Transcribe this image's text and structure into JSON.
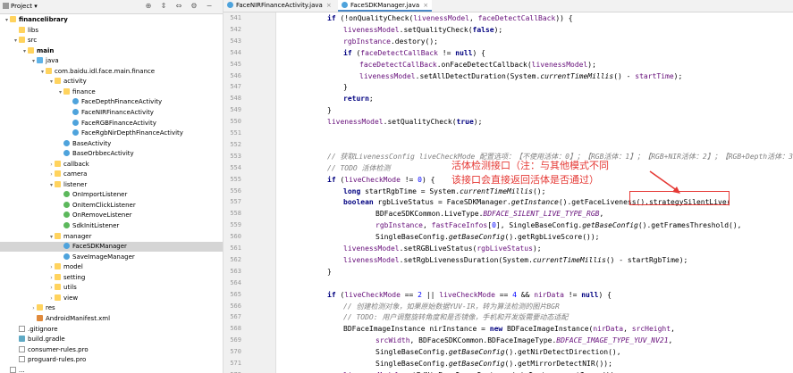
{
  "project_panel": {
    "title": "Project",
    "title_chevron": "▾",
    "toolbar_icons": [
      "target-icon",
      "expand-icon",
      "collapse-icon",
      "gear-icon",
      "minimize-icon"
    ],
    "toolbar_glyphs": [
      "⊕",
      "⇕",
      "⇔",
      "⚙",
      "−"
    ],
    "tree": [
      {
        "label": "financelibrary",
        "depth": 0,
        "chev": "▾",
        "icon": "folder",
        "bold": true
      },
      {
        "label": "libs",
        "depth": 1,
        "chev": "",
        "icon": "folder"
      },
      {
        "label": "src",
        "depth": 1,
        "chev": "▾",
        "icon": "folder"
      },
      {
        "label": "main",
        "depth": 2,
        "chev": "▾",
        "icon": "folder",
        "bold": true
      },
      {
        "label": "java",
        "depth": 3,
        "chev": "▾",
        "icon": "src"
      },
      {
        "label": "com.baidu.idl.face.main.finance",
        "depth": 4,
        "chev": "▾",
        "icon": "pkg"
      },
      {
        "label": "activity",
        "depth": 5,
        "chev": "▾",
        "icon": "pkg"
      },
      {
        "label": "finance",
        "depth": 6,
        "chev": "▾",
        "icon": "pkg"
      },
      {
        "label": "FaceDepthFinanceActivity",
        "depth": 7,
        "chev": "",
        "icon": "class"
      },
      {
        "label": "FaceNIRFinanceActivity",
        "depth": 7,
        "chev": "",
        "icon": "class"
      },
      {
        "label": "FaceRGBFinanceActivity",
        "depth": 7,
        "chev": "",
        "icon": "class"
      },
      {
        "label": "FaceRgbNirDepthFinanceActivity",
        "depth": 7,
        "chev": "",
        "icon": "class"
      },
      {
        "label": "BaseActivity",
        "depth": 6,
        "chev": "",
        "icon": "class"
      },
      {
        "label": "BaseOrbbecActivity",
        "depth": 6,
        "chev": "",
        "icon": "class"
      },
      {
        "label": "callback",
        "depth": 5,
        "chev": "›",
        "icon": "pkg"
      },
      {
        "label": "camera",
        "depth": 5,
        "chev": "›",
        "icon": "pkg"
      },
      {
        "label": "listener",
        "depth": 5,
        "chev": "▾",
        "icon": "pkg"
      },
      {
        "label": "OnImportListener",
        "depth": 6,
        "chev": "",
        "icon": "iface"
      },
      {
        "label": "OnItemClickListener",
        "depth": 6,
        "chev": "",
        "icon": "iface"
      },
      {
        "label": "OnRemoveListener",
        "depth": 6,
        "chev": "",
        "icon": "iface"
      },
      {
        "label": "SdkInitListener",
        "depth": 6,
        "chev": "",
        "icon": "iface"
      },
      {
        "label": "manager",
        "depth": 5,
        "chev": "▾",
        "icon": "pkg"
      },
      {
        "label": "FaceSDKManager",
        "depth": 6,
        "chev": "",
        "icon": "class",
        "selected": true
      },
      {
        "label": "SaveImageManager",
        "depth": 6,
        "chev": "",
        "icon": "class"
      },
      {
        "label": "model",
        "depth": 5,
        "chev": "›",
        "icon": "pkg"
      },
      {
        "label": "setting",
        "depth": 5,
        "chev": "›",
        "icon": "pkg"
      },
      {
        "label": "utils",
        "depth": 5,
        "chev": "›",
        "icon": "pkg"
      },
      {
        "label": "view",
        "depth": 5,
        "chev": "›",
        "icon": "pkg"
      },
      {
        "label": "res",
        "depth": 3,
        "chev": "›",
        "icon": "folder"
      },
      {
        "label": "AndroidManifest.xml",
        "depth": 3,
        "chev": "",
        "icon": "xml"
      },
      {
        "label": ".gitignore",
        "depth": 1,
        "chev": "",
        "icon": "file"
      },
      {
        "label": "build.gradle",
        "depth": 1,
        "chev": "",
        "icon": "gradle"
      },
      {
        "label": "consumer-rules.pro",
        "depth": 1,
        "chev": "",
        "icon": "file"
      },
      {
        "label": "proguard-rules.pro",
        "depth": 1,
        "chev": "",
        "icon": "file"
      },
      {
        "label": "...",
        "depth": 0,
        "chev": "",
        "icon": "file"
      }
    ]
  },
  "editor": {
    "tabs": [
      {
        "label": "FaceNIRFinanceActivity.java",
        "close": "×",
        "active": false
      },
      {
        "label": "FaceSDKManager.java",
        "close": "×",
        "active": true
      }
    ],
    "lines": [
      {
        "num": "541",
        "indent": 0,
        "tokens": [
          [
            "kw",
            "if "
          ],
          [
            "",
            "(!onQualityCheck("
          ],
          [
            "fld",
            "livenessModel"
          ],
          [
            "",
            ", "
          ],
          [
            "fld",
            "faceDetectCallBack"
          ],
          [
            "",
            ")) {"
          ]
        ]
      },
      {
        "num": "542",
        "indent": 1,
        "tokens": [
          [
            "fld",
            "livenessModel"
          ],
          [
            "",
            ".setQualityCheck("
          ],
          [
            "kw",
            "false"
          ],
          [
            "",
            ");"
          ]
        ]
      },
      {
        "num": "543",
        "indent": 1,
        "tokens": [
          [
            "fld",
            "rgbInstance"
          ],
          [
            "",
            ".destory();"
          ]
        ]
      },
      {
        "num": "544",
        "indent": 1,
        "tokens": [
          [
            "kw",
            "if "
          ],
          [
            "",
            "("
          ],
          [
            "fld",
            "faceDetectCallBack"
          ],
          [
            "",
            " != "
          ],
          [
            "kw",
            "null"
          ],
          [
            "",
            ") {"
          ]
        ]
      },
      {
        "num": "545",
        "indent": 2,
        "tokens": [
          [
            "fld",
            "faceDetectCallBack"
          ],
          [
            "",
            ".onFaceDetectCallback("
          ],
          [
            "fld",
            "livenessModel"
          ],
          [
            "",
            ");"
          ]
        ]
      },
      {
        "num": "546",
        "indent": 2,
        "tokens": [
          [
            "fld",
            "livenessModel"
          ],
          [
            "",
            ".setAllDetectDuration(System."
          ],
          [
            "st",
            "currentTimeMillis"
          ],
          [
            "",
            "() - "
          ],
          [
            "fld",
            "startTime"
          ],
          [
            "",
            ");"
          ]
        ]
      },
      {
        "num": "547",
        "indent": 1,
        "tokens": [
          [
            "",
            "}"
          ]
        ]
      },
      {
        "num": "548",
        "indent": 1,
        "tokens": [
          [
            "kw",
            "return"
          ],
          [
            "",
            ";"
          ]
        ]
      },
      {
        "num": "549",
        "indent": 0,
        "tokens": [
          [
            "",
            "}"
          ]
        ]
      },
      {
        "num": "550",
        "indent": 0,
        "tokens": [
          [
            "fld",
            "livenessModel"
          ],
          [
            "",
            ".setQualityCheck("
          ],
          [
            "kw",
            "true"
          ],
          [
            "",
            ");"
          ]
        ]
      },
      {
        "num": "551",
        "indent": 0,
        "tokens": []
      },
      {
        "num": "552",
        "indent": 0,
        "tokens": []
      },
      {
        "num": "553",
        "indent": 0,
        "tokens": [
          [
            "cm",
            "// 获取LivenessConfig liveCheckMode 配置选项：【不使用活体：0】；【RGB活体：1】；【RGB+NIR活体：2】；【RGB+Depth活体：3】；【RGB+NIR+Depth活体：4】"
          ]
        ]
      },
      {
        "num": "554",
        "indent": 0,
        "tokens": [
          [
            "cm",
            "// TODO 活体检测"
          ]
        ]
      },
      {
        "num": "555",
        "indent": 0,
        "tokens": [
          [
            "kw",
            "if "
          ],
          [
            "",
            "("
          ],
          [
            "fld",
            "liveCheckMode"
          ],
          [
            "",
            " != "
          ],
          [
            "num",
            "0"
          ],
          [
            "",
            ") {"
          ]
        ]
      },
      {
        "num": "556",
        "indent": 1,
        "tokens": [
          [
            "kw",
            "long "
          ],
          [
            "",
            "startRgbTime = System."
          ],
          [
            "st",
            "currentTimeMillis"
          ],
          [
            "",
            "();"
          ]
        ]
      },
      {
        "num": "557",
        "indent": 1,
        "tokens": [
          [
            "kw",
            "boolean "
          ],
          [
            "",
            "rgbLiveStatus = FaceSDKManager."
          ],
          [
            "st",
            "getInstance"
          ],
          [
            "",
            "().getFaceLiveness().strategySilentLive("
          ]
        ]
      },
      {
        "num": "558",
        "indent": 3,
        "tokens": [
          [
            "",
            "BDFaceSDKCommon.LiveType."
          ],
          [
            "cst",
            "BDFACE_SILENT_LIVE_TYPE_RGB"
          ],
          [
            "",
            ","
          ]
        ]
      },
      {
        "num": "559",
        "indent": 3,
        "tokens": [
          [
            "fld",
            "rgbInstance"
          ],
          [
            "",
            ", "
          ],
          [
            "fld",
            "fastFaceInfos"
          ],
          [
            "",
            "["
          ],
          [
            "num",
            "0"
          ],
          [
            "",
            "], SingleBaseConfig."
          ],
          [
            "st",
            "getBaseConfig"
          ],
          [
            "",
            "().getFramesThreshold(),"
          ]
        ]
      },
      {
        "num": "560",
        "indent": 3,
        "tokens": [
          [
            "",
            "SingleBaseConfig."
          ],
          [
            "st",
            "getBaseConfig"
          ],
          [
            "",
            "().getRgbLiveScore());"
          ]
        ]
      },
      {
        "num": "561",
        "indent": 1,
        "tokens": [
          [
            "fld",
            "livenessModel"
          ],
          [
            "",
            ".setRGBLiveStatus("
          ],
          [
            "fld",
            "rgbLiveStatus"
          ],
          [
            "",
            ");"
          ]
        ]
      },
      {
        "num": "562",
        "indent": 1,
        "tokens": [
          [
            "fld",
            "livenessModel"
          ],
          [
            "",
            ".setRgbLivenessDuration(System."
          ],
          [
            "st",
            "currentTimeMillis"
          ],
          [
            "",
            "() - startRgbTime);"
          ]
        ]
      },
      {
        "num": "563",
        "indent": 0,
        "tokens": [
          [
            "",
            "}"
          ]
        ]
      },
      {
        "num": "564",
        "indent": 0,
        "tokens": []
      },
      {
        "num": "565",
        "indent": 0,
        "tokens": [
          [
            "kw",
            "if "
          ],
          [
            "",
            "("
          ],
          [
            "fld",
            "liveCheckMode"
          ],
          [
            "",
            " == "
          ],
          [
            "num",
            "2"
          ],
          [
            "",
            " || "
          ],
          [
            "fld",
            "liveCheckMode"
          ],
          [
            "",
            " == "
          ],
          [
            "num",
            "4"
          ],
          [
            "",
            " && "
          ],
          [
            "fld",
            "nirData"
          ],
          [
            "",
            " != "
          ],
          [
            "kw",
            "null"
          ],
          [
            "",
            ") {"
          ]
        ]
      },
      {
        "num": "566",
        "indent": 1,
        "tokens": [
          [
            "cm",
            "// 创建检测对象，如果原始数据YUV-IR，转为算法检测的图片BGR"
          ]
        ]
      },
      {
        "num": "567",
        "indent": 1,
        "tokens": [
          [
            "cm",
            "// TODO: 用户调整旋转角度和是否镜像，手机和开发版需要动态适配"
          ]
        ]
      },
      {
        "num": "568",
        "indent": 1,
        "tokens": [
          [
            "",
            "BDFaceImageInstance nirInstance = "
          ],
          [
            "kw",
            "new "
          ],
          [
            "",
            "BDFaceImageInstance("
          ],
          [
            "fld",
            "nirData"
          ],
          [
            "",
            ", "
          ],
          [
            "fld",
            "srcHeight"
          ],
          [
            "",
            ","
          ]
        ]
      },
      {
        "num": "569",
        "indent": 3,
        "tokens": [
          [
            "fld",
            "srcWidth"
          ],
          [
            "",
            ", BDFaceSDKCommon.BDFaceImageType."
          ],
          [
            "cst",
            "BDFACE_IMAGE_TYPE_YUV_NV21"
          ],
          [
            "",
            ","
          ]
        ]
      },
      {
        "num": "570",
        "indent": 3,
        "tokens": [
          [
            "",
            "SingleBaseConfig."
          ],
          [
            "st",
            "getBaseConfig"
          ],
          [
            "",
            "().getNirDetectDirection(),"
          ]
        ]
      },
      {
        "num": "571",
        "indent": 3,
        "tokens": [
          [
            "",
            "SingleBaseConfig."
          ],
          [
            "st",
            "getBaseConfig"
          ],
          [
            "",
            "().getMirrorDetectNIR());"
          ]
        ]
      },
      {
        "num": "572",
        "indent": 1,
        "tokens": [
          [
            "fld",
            "livenessModel"
          ],
          [
            "",
            ".setBdNirFaceImageInstance(nirInstance.getImage());"
          ]
        ]
      }
    ]
  },
  "annotation": {
    "text_line1": "活体检测接口（注：与其他模式不同",
    "text_line2": "该接口会直接返回活体是否通过）",
    "color": "#e53935",
    "target": "strategySilentLive("
  }
}
